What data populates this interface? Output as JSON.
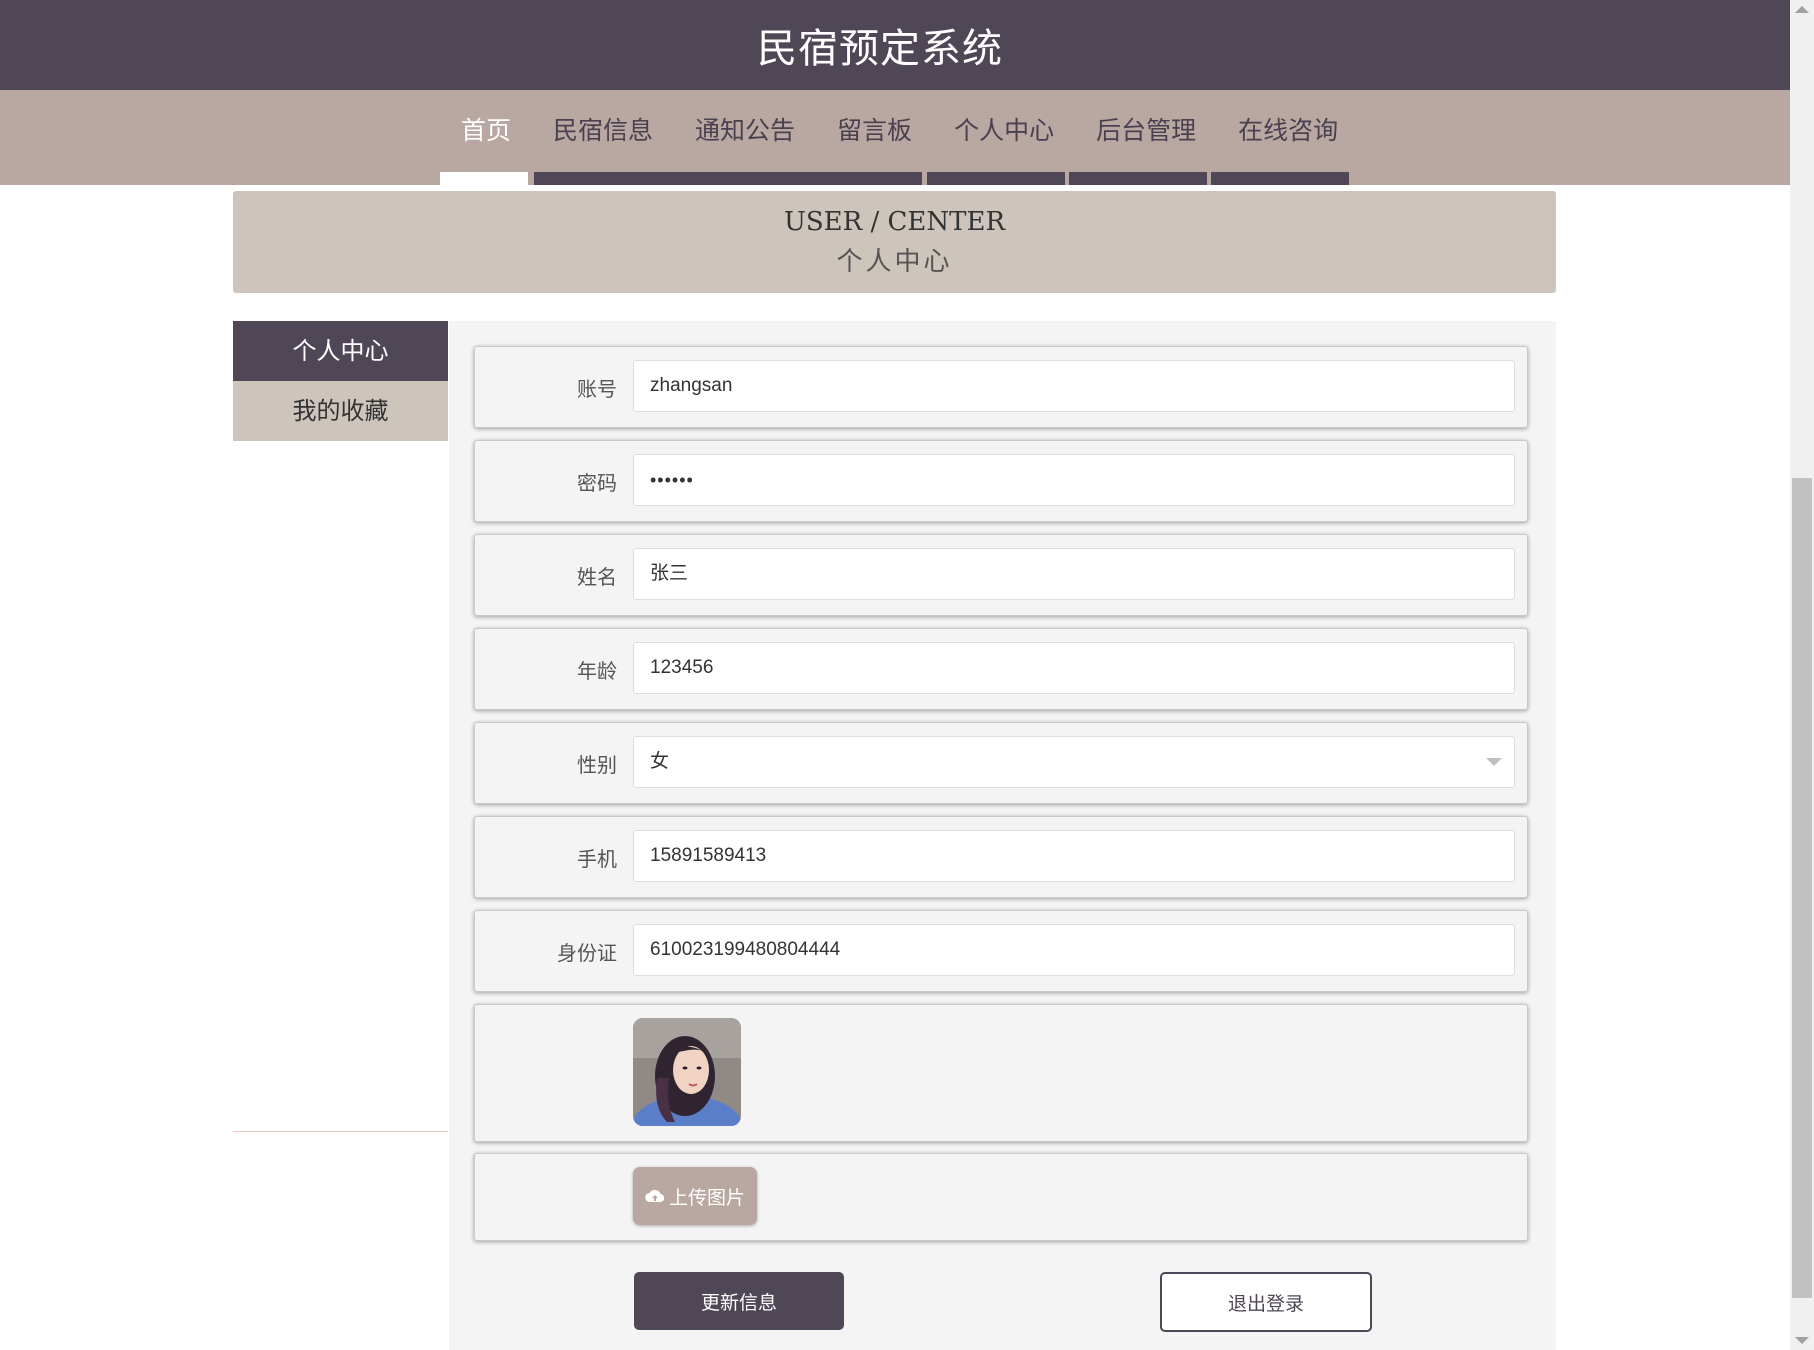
{
  "header": {
    "title": "民宿预定系统"
  },
  "nav": {
    "items": [
      "首页",
      "民宿信息",
      "通知公告",
      "留言板",
      "个人中心",
      "后台管理",
      "在线咨询"
    ],
    "active_index": 0
  },
  "banner": {
    "en": "USER / CENTER",
    "zh": "个人中心"
  },
  "sidebar": {
    "items": [
      "个人中心",
      "我的收藏"
    ],
    "active_index": 0
  },
  "form": {
    "account": {
      "label": "账号",
      "value": "zhangsan"
    },
    "password": {
      "label": "密码",
      "value": "••••••"
    },
    "name": {
      "label": "姓名",
      "value": "张三"
    },
    "age": {
      "label": "年龄",
      "value": "123456"
    },
    "gender": {
      "label": "性别",
      "value": "女"
    },
    "phone": {
      "label": "手机",
      "value": "15891589413"
    },
    "id_card": {
      "label": "身份证",
      "value": "610023199480804444"
    }
  },
  "upload": {
    "label": "上传图片",
    "icon": "cloud-upload-icon"
  },
  "actions": {
    "update": "更新信息",
    "logout": "退出登录"
  },
  "colors": {
    "dark": "#4f4756",
    "taupe": "#b8a8a1",
    "beige": "#cdc4bc",
    "panel": "#f4f4f4"
  }
}
